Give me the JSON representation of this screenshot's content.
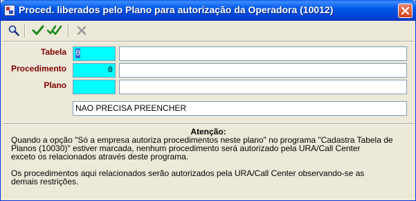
{
  "window": {
    "title": "Proced. liberados pelo Plano para autorização da Operadora (10012)"
  },
  "toolbar": {
    "buttons": [
      {
        "icon": "magnifier-icon"
      },
      {
        "icon": "check-icon"
      },
      {
        "icon": "double-check-icon"
      },
      {
        "icon": "x-icon",
        "disabled": true
      }
    ]
  },
  "form": {
    "tabela": {
      "label": "Tabela",
      "code": "0",
      "description": ""
    },
    "procedimento": {
      "label": "Procedimento",
      "code": "0",
      "description": ""
    },
    "plano": {
      "label": "Plano",
      "code": "",
      "description": ""
    },
    "note": "NAO PRECISA PREENCHER"
  },
  "info": {
    "title": "Atenção:",
    "line1": "Quando a opção \"Só a empresa autoriza procedimentos neste plano\" no programa \"Cadastra Tabela de",
    "line2": "Planos (10030)\" estiver marcada, nenhum procedimento será autorizado pela URA/Call Center",
    "line3": "exceto os relacionados através deste programa.",
    "line4": "Os procedimentos aqui relacionados serão autorizados pela URA/Call Center observando-se as",
    "line5": "demais restrições."
  },
  "colors": {
    "label_color": "#800000",
    "field_cyan": "#00ffff",
    "title_blue": "#0058e6"
  }
}
